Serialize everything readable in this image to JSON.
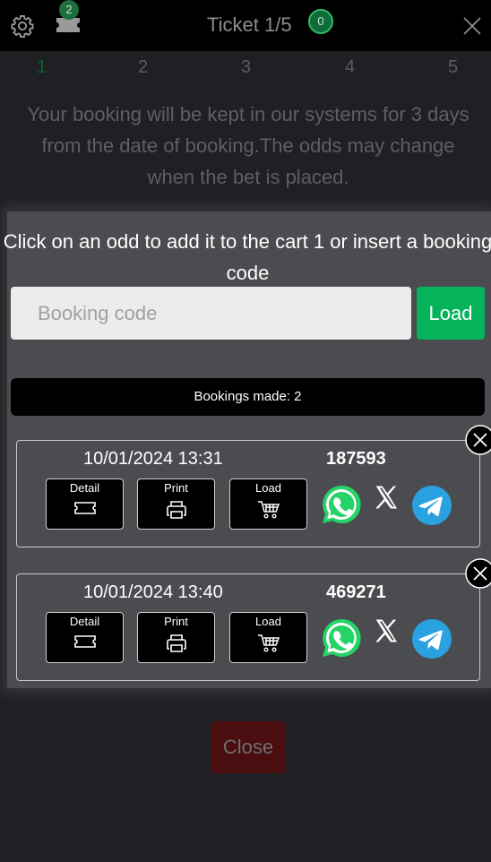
{
  "header": {
    "title": "Ticket 1/5",
    "ticket_count": "2",
    "cart_count": "0",
    "accent": "#06b25a"
  },
  "steps": [
    "1",
    "2",
    "3",
    "4",
    "5"
  ],
  "info_text": "Your booking will be kept in our systems for 3 days from the date of booking.The odds may change when the bet is placed.",
  "panel": {
    "instruction": "Click on an odd to add it to the cart 1 or insert a booking code",
    "booking_placeholder": "Booking code",
    "booking_value": "",
    "load_label": "Load",
    "bookings_made": "Bookings made: 2"
  },
  "bookings": [
    {
      "date": "10/01/2024 13:31",
      "code": "187593",
      "detail_label": "Detail",
      "print_label": "Print",
      "load_label": "Load"
    },
    {
      "date": "10/01/2024 13:40",
      "code": "469271",
      "detail_label": "Detail",
      "print_label": "Print",
      "load_label": "Load"
    }
  ],
  "icons": [
    "gear-icon",
    "ticket-icon",
    "close-icon",
    "whatsapp-icon",
    "x-logo-icon",
    "telegram-icon",
    "printer-icon",
    "cart-icon"
  ],
  "footer": {
    "close_label": "Close"
  }
}
